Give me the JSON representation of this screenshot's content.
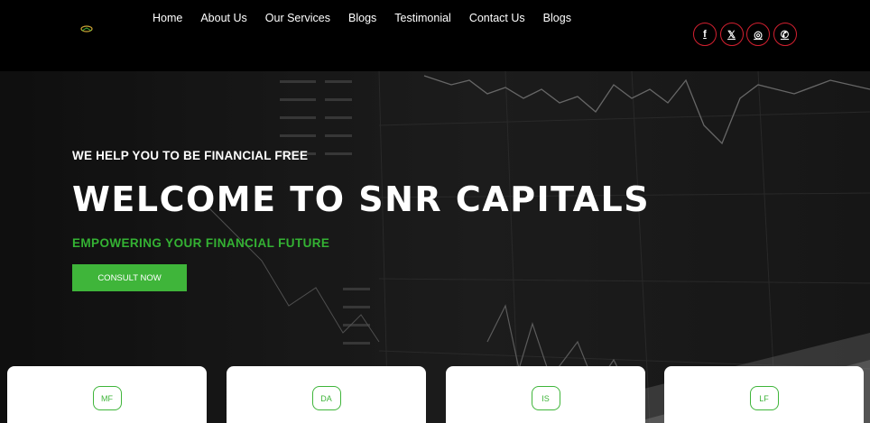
{
  "header": {
    "logo_icon": "snr-capitals-logo",
    "nav": [
      {
        "label": "Home"
      },
      {
        "label": "About Us"
      },
      {
        "label": "Our Services"
      },
      {
        "label": "Blogs"
      },
      {
        "label": "Testimonial"
      },
      {
        "label": "Contact Us"
      },
      {
        "label": "Blogs"
      }
    ],
    "social": [
      {
        "icon": "facebook-icon",
        "glyph": "f"
      },
      {
        "icon": "x-icon",
        "glyph": "𝕏"
      },
      {
        "icon": "instagram-icon",
        "glyph": "◎"
      },
      {
        "icon": "whatsapp-icon",
        "glyph": "✆"
      }
    ]
  },
  "hero": {
    "tagline": "WE HELP YOU TO BE FINANCIAL FREE",
    "headline": "WELCOME TO SNR CAPITALS",
    "subline": "EMPOWERING YOUR FINANCIAL FUTURE",
    "cta_label": "CONSULT NOW"
  },
  "cards": [
    {
      "badge": "MF"
    },
    {
      "badge": "DA"
    },
    {
      "badge": "IS"
    },
    {
      "badge": "LF"
    }
  ],
  "colors": {
    "accent_green": "#3fb53a",
    "social_red": "#d32030",
    "header_bg": "#000000"
  }
}
